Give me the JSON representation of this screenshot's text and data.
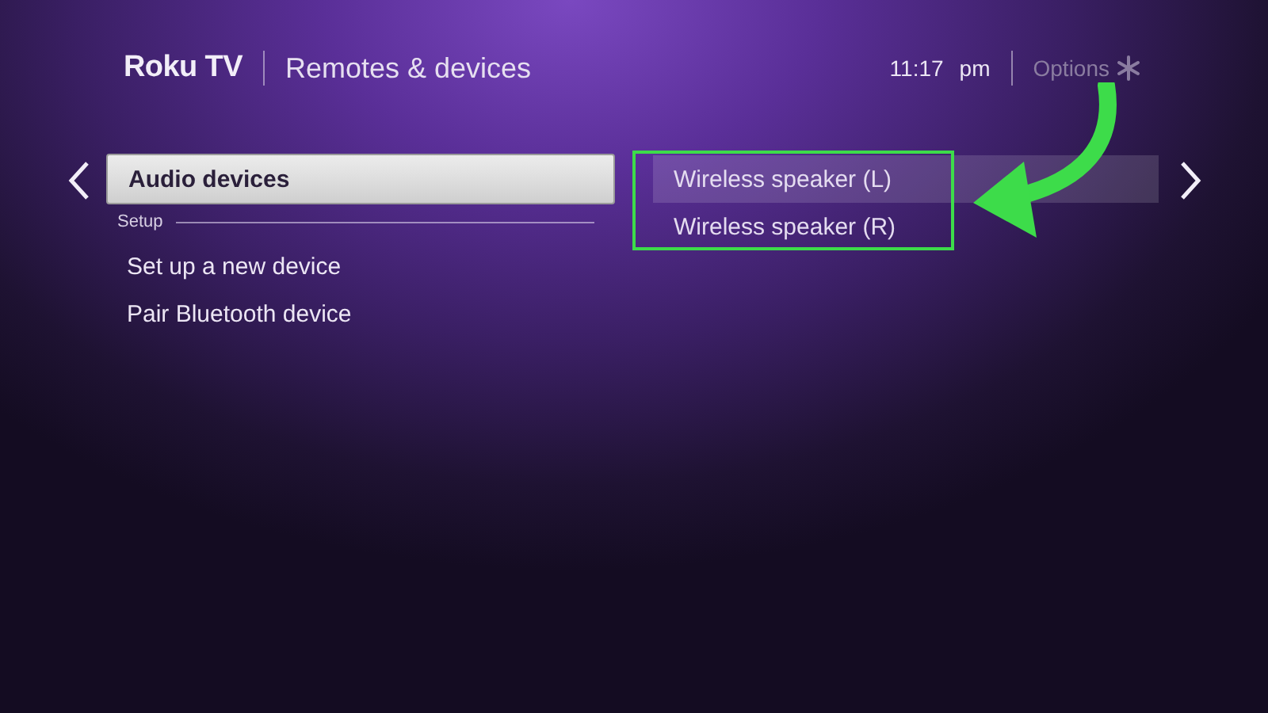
{
  "header": {
    "logo": "Roku TV",
    "title": "Remotes & devices",
    "time": "11:17",
    "period": "pm",
    "options_label": "Options"
  },
  "menu": {
    "items": [
      {
        "label": "Audio devices",
        "selected": true
      }
    ],
    "section": {
      "label": "Setup",
      "items": [
        {
          "label": "Set up a new device",
          "selected": false
        },
        {
          "label": "Pair Bluetooth device",
          "selected": false
        }
      ]
    }
  },
  "devices": [
    {
      "label": "Wireless speaker (L)",
      "selected": true
    },
    {
      "label": "Wireless speaker (R)",
      "selected": false
    }
  ]
}
